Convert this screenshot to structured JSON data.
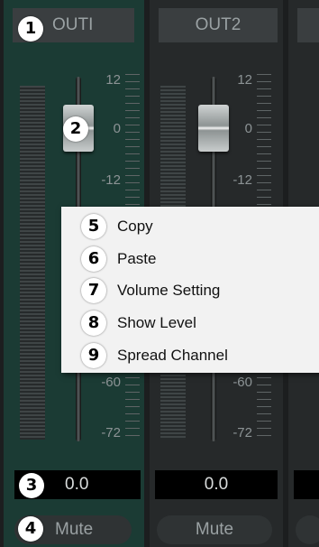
{
  "channels": [
    {
      "title": "OUTI",
      "scale": [
        "12",
        "0",
        "-12",
        "-60",
        "-72"
      ],
      "value": "0.0",
      "mute_label": "Mute"
    },
    {
      "title": "OUT2",
      "scale": [
        "12",
        "0",
        "-12",
        "-60",
        "-72"
      ],
      "value": "0.0",
      "mute_label": "Mute"
    }
  ],
  "badges": {
    "channel_title": "1",
    "fader": "2",
    "value": "3",
    "mute": "4"
  },
  "context_menu": {
    "items": [
      {
        "num": "5",
        "label": "Copy"
      },
      {
        "num": "6",
        "label": "Paste"
      },
      {
        "num": "7",
        "label": "Volume Setting"
      },
      {
        "num": "8",
        "label": "Show Level"
      },
      {
        "num": "9",
        "label": "Spread Channel"
      }
    ]
  },
  "colors": {
    "active_strip": "#1b3b34",
    "strip": "#26292a",
    "menu_background": "#f2f2f2"
  }
}
